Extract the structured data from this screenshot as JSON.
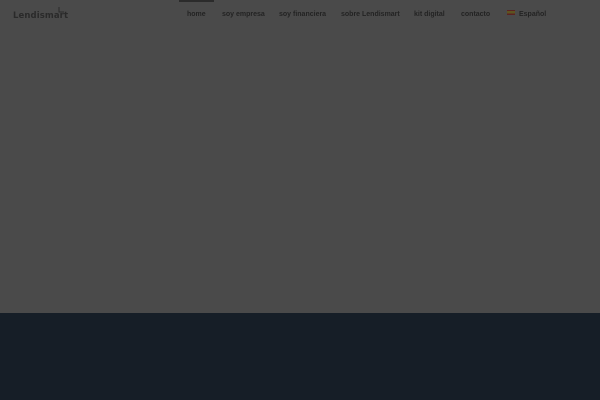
{
  "brand": {
    "name": "Lendismart",
    "logo_icon": "lendismart-mark-icon"
  },
  "nav": {
    "items": [
      {
        "label": "home",
        "active": true
      },
      {
        "label": "soy empresa",
        "active": false
      },
      {
        "label": "soy financiera",
        "active": false
      },
      {
        "label": "sobre Lendismart",
        "active": false
      },
      {
        "label": "kit digital",
        "active": false
      },
      {
        "label": "contacto",
        "active": false
      }
    ],
    "language": {
      "label": "Español",
      "icon": "spain-flag-icon"
    }
  },
  "colors": {
    "overlay": "#4a4a4a",
    "footer": "#161e27",
    "nav_text": "#232323"
  }
}
